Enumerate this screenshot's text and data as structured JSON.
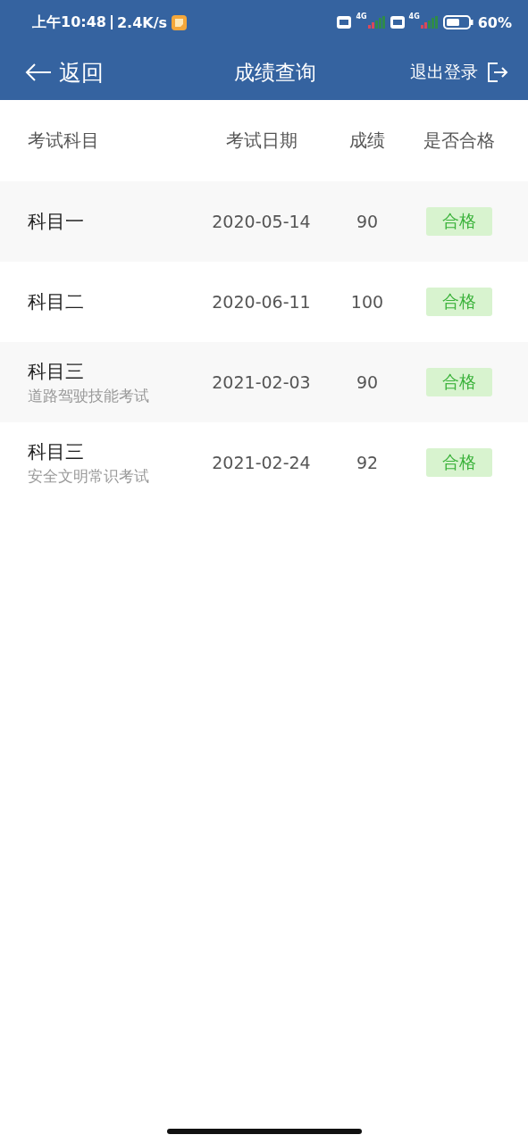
{
  "status_bar": {
    "time": "上午10:48",
    "speed": "2.4K/s",
    "network_1": "4G",
    "network_2": "4G",
    "battery": "60%"
  },
  "header": {
    "back": "返回",
    "title": "成绩查询",
    "logout": "退出登录"
  },
  "table": {
    "columns": [
      "考试科目",
      "考试日期",
      "成绩",
      "是否合格"
    ],
    "rows": [
      {
        "subject": "科目一",
        "date": "2020-05-14",
        "score": "90",
        "result": "合格",
        "passed": true
      },
      {
        "subject": "科目二",
        "date": "2020-06-11",
        "score": "100",
        "result": "合格",
        "passed": true
      },
      {
        "subject": "科目三",
        "detail": "道路驾驶技能考试",
        "date": "2021-02-03",
        "score": "90",
        "result": "合格",
        "passed": true
      },
      {
        "subject": "科目三",
        "detail": "安全文明常识考试",
        "date": "2021-02-24",
        "score": "92",
        "result": "合格",
        "passed": true
      }
    ]
  }
}
